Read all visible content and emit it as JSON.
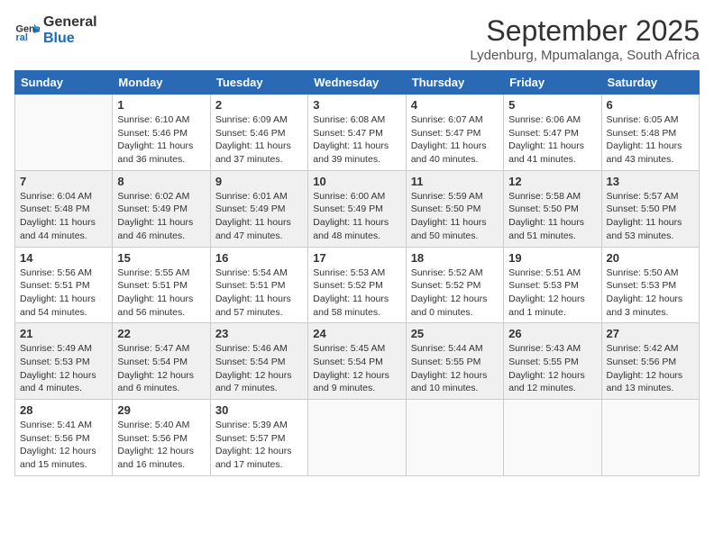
{
  "logo": {
    "line1": "General",
    "line2": "Blue"
  },
  "title": "September 2025",
  "subtitle": "Lydenburg, Mpumalanga, South Africa",
  "weekdays": [
    "Sunday",
    "Monday",
    "Tuesday",
    "Wednesday",
    "Thursday",
    "Friday",
    "Saturday"
  ],
  "weeks": [
    [
      {
        "day": "",
        "info": ""
      },
      {
        "day": "1",
        "info": "Sunrise: 6:10 AM\nSunset: 5:46 PM\nDaylight: 11 hours\nand 36 minutes."
      },
      {
        "day": "2",
        "info": "Sunrise: 6:09 AM\nSunset: 5:46 PM\nDaylight: 11 hours\nand 37 minutes."
      },
      {
        "day": "3",
        "info": "Sunrise: 6:08 AM\nSunset: 5:47 PM\nDaylight: 11 hours\nand 39 minutes."
      },
      {
        "day": "4",
        "info": "Sunrise: 6:07 AM\nSunset: 5:47 PM\nDaylight: 11 hours\nand 40 minutes."
      },
      {
        "day": "5",
        "info": "Sunrise: 6:06 AM\nSunset: 5:47 PM\nDaylight: 11 hours\nand 41 minutes."
      },
      {
        "day": "6",
        "info": "Sunrise: 6:05 AM\nSunset: 5:48 PM\nDaylight: 11 hours\nand 43 minutes."
      }
    ],
    [
      {
        "day": "7",
        "info": "Sunrise: 6:04 AM\nSunset: 5:48 PM\nDaylight: 11 hours\nand 44 minutes."
      },
      {
        "day": "8",
        "info": "Sunrise: 6:02 AM\nSunset: 5:49 PM\nDaylight: 11 hours\nand 46 minutes."
      },
      {
        "day": "9",
        "info": "Sunrise: 6:01 AM\nSunset: 5:49 PM\nDaylight: 11 hours\nand 47 minutes."
      },
      {
        "day": "10",
        "info": "Sunrise: 6:00 AM\nSunset: 5:49 PM\nDaylight: 11 hours\nand 48 minutes."
      },
      {
        "day": "11",
        "info": "Sunrise: 5:59 AM\nSunset: 5:50 PM\nDaylight: 11 hours\nand 50 minutes."
      },
      {
        "day": "12",
        "info": "Sunrise: 5:58 AM\nSunset: 5:50 PM\nDaylight: 11 hours\nand 51 minutes."
      },
      {
        "day": "13",
        "info": "Sunrise: 5:57 AM\nSunset: 5:50 PM\nDaylight: 11 hours\nand 53 minutes."
      }
    ],
    [
      {
        "day": "14",
        "info": "Sunrise: 5:56 AM\nSunset: 5:51 PM\nDaylight: 11 hours\nand 54 minutes."
      },
      {
        "day": "15",
        "info": "Sunrise: 5:55 AM\nSunset: 5:51 PM\nDaylight: 11 hours\nand 56 minutes."
      },
      {
        "day": "16",
        "info": "Sunrise: 5:54 AM\nSunset: 5:51 PM\nDaylight: 11 hours\nand 57 minutes."
      },
      {
        "day": "17",
        "info": "Sunrise: 5:53 AM\nSunset: 5:52 PM\nDaylight: 11 hours\nand 58 minutes."
      },
      {
        "day": "18",
        "info": "Sunrise: 5:52 AM\nSunset: 5:52 PM\nDaylight: 12 hours\nand 0 minutes."
      },
      {
        "day": "19",
        "info": "Sunrise: 5:51 AM\nSunset: 5:53 PM\nDaylight: 12 hours\nand 1 minute."
      },
      {
        "day": "20",
        "info": "Sunrise: 5:50 AM\nSunset: 5:53 PM\nDaylight: 12 hours\nand 3 minutes."
      }
    ],
    [
      {
        "day": "21",
        "info": "Sunrise: 5:49 AM\nSunset: 5:53 PM\nDaylight: 12 hours\nand 4 minutes."
      },
      {
        "day": "22",
        "info": "Sunrise: 5:47 AM\nSunset: 5:54 PM\nDaylight: 12 hours\nand 6 minutes."
      },
      {
        "day": "23",
        "info": "Sunrise: 5:46 AM\nSunset: 5:54 PM\nDaylight: 12 hours\nand 7 minutes."
      },
      {
        "day": "24",
        "info": "Sunrise: 5:45 AM\nSunset: 5:54 PM\nDaylight: 12 hours\nand 9 minutes."
      },
      {
        "day": "25",
        "info": "Sunrise: 5:44 AM\nSunset: 5:55 PM\nDaylight: 12 hours\nand 10 minutes."
      },
      {
        "day": "26",
        "info": "Sunrise: 5:43 AM\nSunset: 5:55 PM\nDaylight: 12 hours\nand 12 minutes."
      },
      {
        "day": "27",
        "info": "Sunrise: 5:42 AM\nSunset: 5:56 PM\nDaylight: 12 hours\nand 13 minutes."
      }
    ],
    [
      {
        "day": "28",
        "info": "Sunrise: 5:41 AM\nSunset: 5:56 PM\nDaylight: 12 hours\nand 15 minutes."
      },
      {
        "day": "29",
        "info": "Sunrise: 5:40 AM\nSunset: 5:56 PM\nDaylight: 12 hours\nand 16 minutes."
      },
      {
        "day": "30",
        "info": "Sunrise: 5:39 AM\nSunset: 5:57 PM\nDaylight: 12 hours\nand 17 minutes."
      },
      {
        "day": "",
        "info": ""
      },
      {
        "day": "",
        "info": ""
      },
      {
        "day": "",
        "info": ""
      },
      {
        "day": "",
        "info": ""
      }
    ]
  ]
}
